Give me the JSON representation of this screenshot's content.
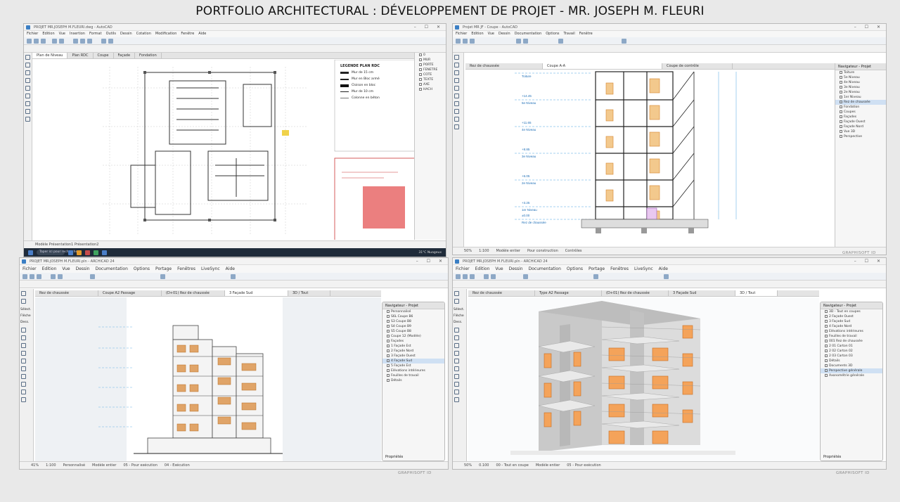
{
  "page": {
    "title": "PORTFOLIO ARCHITECTURAL : DÉVELOPPEMENT DE PROJET - MR. JOSEPH M. FLEURI"
  },
  "win1": {
    "title": "PROJET MR.JOSEPH M.FLEURI.dwg - AutoCAD",
    "menus": [
      "Fichier",
      "Edition",
      "Vue",
      "Insertion",
      "Format",
      "Outils",
      "Dessin",
      "Cotation",
      "Modification",
      "Fenêtre",
      "Aide"
    ],
    "tabs": [
      "Plan de Niveau",
      "Plan RDC",
      "Coupe",
      "Façade",
      "Fondation"
    ],
    "legend": {
      "title": "LEGENDE PLAN RDC",
      "items": [
        "Mur de 15 cm",
        "Mur en Bloc armé",
        "Cloison en bloc",
        "Mur de 10 cm",
        "Colonne en béton"
      ]
    },
    "taskbar": {
      "search": "Taper ici pour rechercher",
      "tray": "31°C Nuageux"
    },
    "status": "Modèle  Présentation1  Présentation2"
  },
  "win2": {
    "title": "Projet MR JF - Coupe - AutoCAD",
    "menus": [
      "Fichier",
      "Edition",
      "Vue",
      "Dessin",
      "Documentation",
      "Options",
      "Travail",
      "Fenêtre"
    ],
    "tabs": [
      "Rez de chaussée",
      "Coupe A-A",
      "Coupe de contrôle"
    ],
    "levels": [
      {
        "elev": "+17.25",
        "label": "Toiture"
      },
      {
        "elev": "+14.45",
        "label": "5e Niveau"
      },
      {
        "elev": "+11.65",
        "label": "4e Niveau"
      },
      {
        "elev": "+8.85",
        "label": "3e Niveau"
      },
      {
        "elev": "+6.05",
        "label": "2e Niveau"
      },
      {
        "elev": "+3.25",
        "label": "1er Niveau"
      },
      {
        "elev": "±0.00",
        "label": "Rez de chaussée"
      }
    ],
    "nav": {
      "head": "Navigateur - Projet",
      "items": [
        "Toiture",
        "5e Niveau",
        "4e Niveau",
        "3e Niveau",
        "2e Niveau",
        "1er Niveau",
        "Rez de chaussée",
        "Fondation",
        "Coupes",
        "Façades",
        "Façade Ouest",
        "Façade Nord",
        "Vue 3D",
        "Perspective"
      ],
      "selected": 6
    },
    "status": [
      "50%",
      "1:100",
      "Modèle entier",
      "Pour construction",
      "Contrôles"
    ],
    "logo": "GRAPHISOFT ID"
  },
  "win3": {
    "title": "PROJET MR.JOSEPH M.FLEURI.pln - ARCHICAD 24",
    "menus": [
      "Fichier",
      "Edition",
      "Vue",
      "Dessin",
      "Documentation",
      "Options",
      "Portage",
      "Fenêtres",
      "LiveSync",
      "Aide"
    ],
    "tabs": [
      "Rez de chaussée",
      "Coupe A2 Passage",
      "(D+01) Rez de chaussée",
      "3 Façade Sud",
      "3D / Tout"
    ],
    "nav": {
      "head": "Navigateur - Projet",
      "items": [
        "Personnalisé",
        "S6L Coupe B6",
        "S3 Coupe B8",
        "S4 Coupe B9",
        "S5 Coupe B8",
        "Coupe 12 (Modèle)",
        "Façades",
        "1 Façade Est",
        "2 Façade Nord",
        "3 Façade Ouest",
        "4 Façade Sud",
        "5 Façade Est",
        "Elévations intérieures",
        "Feuilles de travail",
        "Détails"
      ],
      "selected": 10
    },
    "side_labels": [
      "Sélect.",
      "Flèche",
      "Dess."
    ],
    "status": [
      "41%",
      "1:100",
      "Personnalisé",
      "Modèle entier",
      "05 - Pour exécution",
      "04 - Exécution"
    ],
    "prop": "Propriétés",
    "logo": "GRAPHISOFT ID"
  },
  "win4": {
    "title": "PROJET MR.JOSEPH M.FLEURI.pln - ARCHICAD 24",
    "menus": [
      "Fichier",
      "Edition",
      "Vue",
      "Dessin",
      "Documentation",
      "Options",
      "Portage",
      "Fenêtres",
      "LiveSync",
      "Aide"
    ],
    "tabs": [
      "Rez de chaussée",
      "Type A2 Passage",
      "(D+01) Rez de chaussée",
      "3 Façade Sud",
      "3D / Tout"
    ],
    "nav": {
      "head": "Navigateur - Projet",
      "items": [
        "3D - Tout en coupes",
        "2 Façade Ouest",
        "3 Façade Sud",
        "4 Façade Nord",
        "Elévations intérieures",
        "Feuilles de travail",
        "001 Rez de chaussée",
        "2 01 Carton 01",
        "2 02 Carton 02",
        "2 03 Carton 03",
        "Détails",
        "Documents 3D",
        "Perspective générale",
        "Axonométrie générale"
      ],
      "selected": 12
    },
    "side_labels": [
      "Sélect.",
      "Flèche",
      "Dess."
    ],
    "status": [
      "50%",
      "0.100",
      "00 - Tout en coupe",
      "Modèle entier",
      "05 - Pour exécution"
    ],
    "prop": "Propriétés",
    "logo": "GRAPHISOFT ID"
  }
}
